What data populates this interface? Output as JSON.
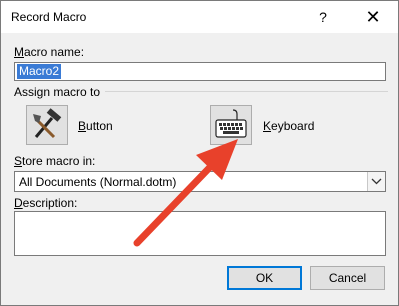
{
  "window": {
    "title": "Record Macro",
    "help_glyph": "?",
    "close_glyph": "✕"
  },
  "macro_name": {
    "label_mnemonic": "M",
    "label_rest": "acro name:",
    "value": "Macro2"
  },
  "assign": {
    "group_label": "Assign macro to",
    "button_mnemonic": "B",
    "button_rest": "utton",
    "keyboard_mnemonic": "K",
    "keyboard_rest": "eyboard",
    "button_icon": "hammer-icon",
    "keyboard_icon": "keyboard-icon"
  },
  "store": {
    "label_mnemonic": "S",
    "label_rest": "tore macro in:",
    "value": "All Documents (Normal.dotm)"
  },
  "description": {
    "label_mnemonic": "D",
    "label_rest": "escription:",
    "value": ""
  },
  "buttons": {
    "ok": "OK",
    "cancel": "Cancel"
  },
  "annotation": {
    "arrow_color": "#e8412b"
  }
}
